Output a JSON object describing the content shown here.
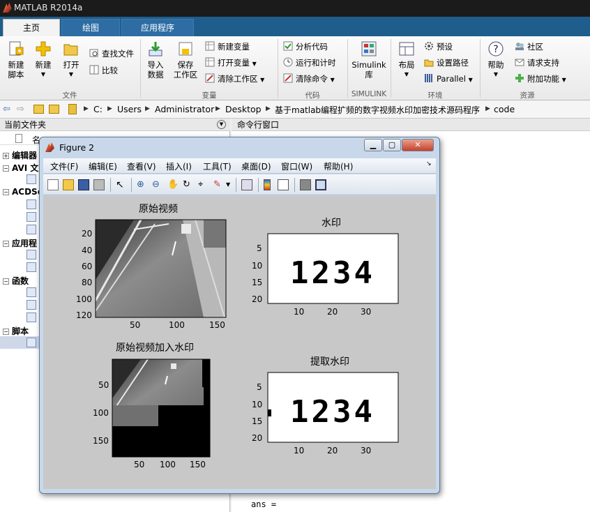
{
  "window": {
    "title": "MATLAB R2014a"
  },
  "tabs": [
    {
      "label": "主页"
    },
    {
      "label": "绘图"
    },
    {
      "label": "应用程序"
    }
  ],
  "ribbon": {
    "file_group": {
      "new_script": "新建\n脚本",
      "new": "新建",
      "open": "打开",
      "find_files": "查找文件",
      "compare": "比较",
      "label": "文件"
    },
    "var_group": {
      "import": "导入\n数据",
      "save_ws": "保存\n工作区",
      "new_var": "新建变量",
      "open_var": "打开变量",
      "clear_ws": "清除工作区",
      "label": "变量"
    },
    "code_group": {
      "analyze": "分析代码",
      "run_time": "运行和计时",
      "clear_cmds": "清除命令",
      "label": "代码"
    },
    "simulink_group": {
      "simulink": "Simulink\n库",
      "label": "SIMULINK"
    },
    "env_group": {
      "layout": "布局",
      "prefs": "预设",
      "set_path": "设置路径",
      "parallel": "Parallel",
      "label": "环境"
    },
    "res_group": {
      "help": "帮助",
      "community": "社区",
      "support": "请求支持",
      "addons": "附加功能",
      "label": "资源"
    }
  },
  "address": {
    "crumbs": [
      "C:",
      "Users",
      "Administrator",
      "Desktop",
      "基于matlab编程扩频的数字视频水印加密技术源码程序",
      "code"
    ]
  },
  "left_panel": {
    "title": "当前文件夹",
    "col": "名",
    "tree": [
      {
        "label": "编辑器"
      },
      {
        "label": "AVI 文"
      },
      {
        "label": "ACDSe"
      },
      {
        "label": "应用程"
      },
      {
        "label": "函数"
      },
      {
        "label": "脚本"
      }
    ]
  },
  "right_panel": {
    "title": "命令行窗口",
    "ans": "ans ="
  },
  "figure": {
    "title": "Figure 2",
    "menu": [
      "文件(F)",
      "编辑(E)",
      "查看(V)",
      "插入(I)",
      "工具(T)",
      "桌面(D)",
      "窗口(W)",
      "帮助(H)"
    ],
    "plots": [
      {
        "title": "原始视频",
        "yticks": [
          "20",
          "40",
          "60",
          "80",
          "100",
          "120"
        ],
        "xticks": [
          "50",
          "100",
          "150"
        ]
      },
      {
        "title": "水印",
        "yticks": [
          "5",
          "10",
          "15",
          "20"
        ],
        "xticks": [
          "10",
          "20",
          "30"
        ]
      },
      {
        "title": "原始视频加入水印",
        "yticks": [
          "50",
          "100",
          "150"
        ],
        "xticks": [
          "50",
          "100",
          "150"
        ]
      },
      {
        "title": "提取水印",
        "yticks": [
          "5",
          "10",
          "15",
          "20"
        ],
        "xticks": [
          "10",
          "20",
          "30"
        ]
      }
    ],
    "watermark_text": "1234"
  }
}
